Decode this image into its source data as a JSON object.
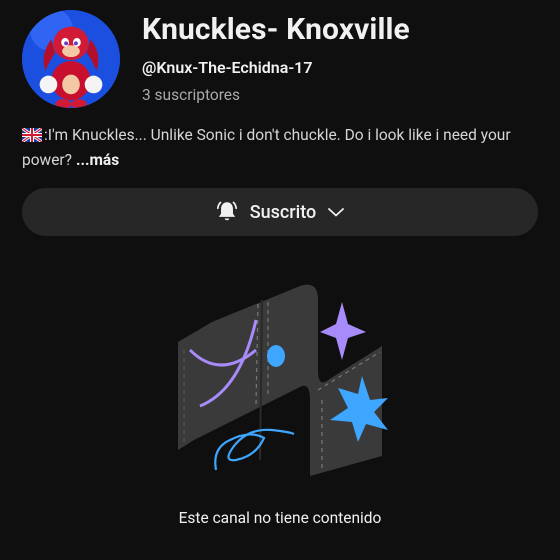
{
  "channel": {
    "name": "Knuckles- Knoxville",
    "handle": "@Knux-The-Echidna-17",
    "subscribers": "3 suscriptores",
    "description": ":I'm Knuckles... Unlike Sonic i don't chuckle. Do i look like i need your power?",
    "more_label": "...más",
    "flag_icon": "uk-flag-icon",
    "avatar_icon": "knuckles-avatar"
  },
  "subscribe": {
    "label": "Suscrito",
    "bell_icon": "bell-icon",
    "chevron_icon": "chevron-down-icon"
  },
  "empty_state": {
    "message": "Este canal no tiene contenido",
    "illustration": "empty-channel-illustration"
  },
  "colors": {
    "background": "#0f0f0f",
    "button": "#272727",
    "purple": "#a78bfa",
    "blue": "#3ea6ff",
    "panel": "#3a3a3a"
  }
}
